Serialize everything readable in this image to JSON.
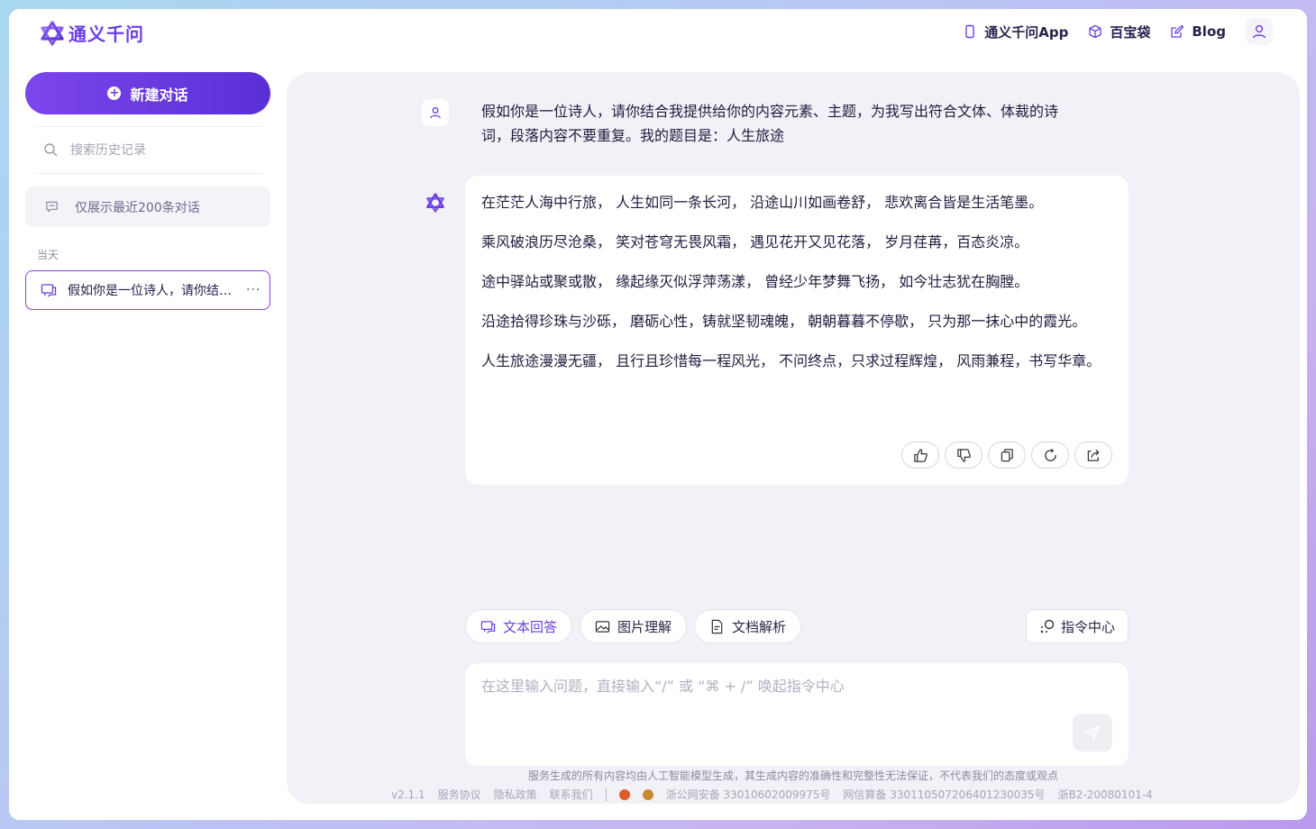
{
  "app": {
    "logo_text": "通义千问",
    "brand_color": "#6b3ee8"
  },
  "header": {
    "nav": [
      {
        "label": "通义千问App",
        "icon": "phone-icon"
      },
      {
        "label": "百宝袋",
        "icon": "box-icon"
      },
      {
        "label": "Blog",
        "icon": "edit-icon"
      }
    ],
    "avatar_icon": "user-icon"
  },
  "sidebar": {
    "new_chat_label": "新建对话",
    "search_placeholder": "搜索历史记录",
    "limit_notice": "仅展示最近200条对话",
    "group_label": "当天",
    "history": [
      {
        "title": "假如你是一位诗人，请你结合我提供给你的内容元素、主题，为我写出符合文体、体裁的诗词"
      }
    ],
    "more_label": "···"
  },
  "chat": {
    "user_message": "假如你是一位诗人，请你结合我提供给你的内容元素、主题，为我写出符合文体、体裁的诗词，段落内容不要重复。我的题目是：人生旅途",
    "answer_paragraphs": [
      "在茫茫人海中行旅， 人生如同一条长河， 沿途山川如画卷舒， 悲欢离合皆是生活笔墨。",
      "乘风破浪历尽沧桑， 笑对苍穹无畏风霜， 遇见花开又见花落， 岁月荏苒，百态炎凉。",
      "途中驿站或聚或散， 缘起缘灭似浮萍荡漾， 曾经少年梦舞飞扬， 如今壮志犹在胸膛。",
      "沿途拾得珍珠与沙砾， 磨砺心性，铸就坚韧魂魄， 朝朝暮暮不停歇， 只为那一抹心中的霞光。",
      "人生旅途漫漫无疆， 且行且珍惜每一程风光， 不问终点，只求过程辉煌， 风雨兼程，书写华章。"
    ],
    "actions": [
      "thumbs-up-icon",
      "thumbs-down-icon",
      "copy-icon",
      "regenerate-icon",
      "share-icon"
    ]
  },
  "composer": {
    "tools": [
      {
        "label": "文本回答",
        "icon": "chat-icon",
        "active": true
      },
      {
        "label": "图片理解",
        "icon": "image-icon",
        "active": false
      },
      {
        "label": "文档解析",
        "icon": "document-icon",
        "active": false
      }
    ],
    "command_center_label": "指令中心",
    "input_placeholder": "在这里输入问题，直接输入“/” 或 “⌘ + /” 唤起指令中心"
  },
  "footer": {
    "disclaimer": "服务生成的所有内容均由人工智能模型生成，其生成内容的准确性和完整性无法保证，不代表我们的态度或观点",
    "version": "v2.1.1",
    "terms": "服务协议",
    "privacy": "隐私政策",
    "contact": "联系我们",
    "police_record": "浙公网安备 33010602009975号",
    "algo_record": "网信算备 330110507206401230035号",
    "icp": "浙B2-20080101-4"
  }
}
